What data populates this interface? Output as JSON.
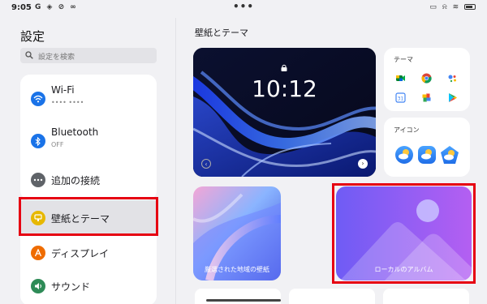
{
  "status_bar": {
    "time": "9:05",
    "left_icons": "G ◈ ⊘ ∞",
    "center_dots": "•••",
    "right_icons": "▭ ⍾ ≋"
  },
  "settings": {
    "title": "設定",
    "search_placeholder": "設定を検索"
  },
  "sidebar": {
    "items": [
      {
        "label": "Wi-Fi",
        "sub": "•••• ••••",
        "icon": "wifi-icon",
        "color": "#1a73e8"
      },
      {
        "label": "Bluetooth",
        "sub": "OFF",
        "icon": "bluetooth-icon",
        "color": "#1a73e8"
      },
      {
        "label": "追加の接続",
        "icon": "more-dots-icon",
        "color": "#5f6368"
      },
      {
        "label": "壁紙とテーマ",
        "icon": "palette-icon",
        "color": "#e7b800"
      },
      {
        "label": "ディスプレイ",
        "icon": "display-icon",
        "color": "#ef6c00"
      },
      {
        "label": "サウンド",
        "icon": "sound-icon",
        "color": "#2e8b57"
      }
    ]
  },
  "main": {
    "title": "壁紙とテーマ",
    "lock_time": "10:12",
    "theme_label": "テーマ",
    "icon_label": "アイコン",
    "wallpapers": [
      {
        "label": "厳選された地域の壁紙"
      },
      {
        "label": "ローカルのアルバム"
      }
    ]
  },
  "colors": {
    "highlight": "#e60012",
    "selected_bg": "#e2e2e6",
    "background": "#f1f1f4"
  }
}
